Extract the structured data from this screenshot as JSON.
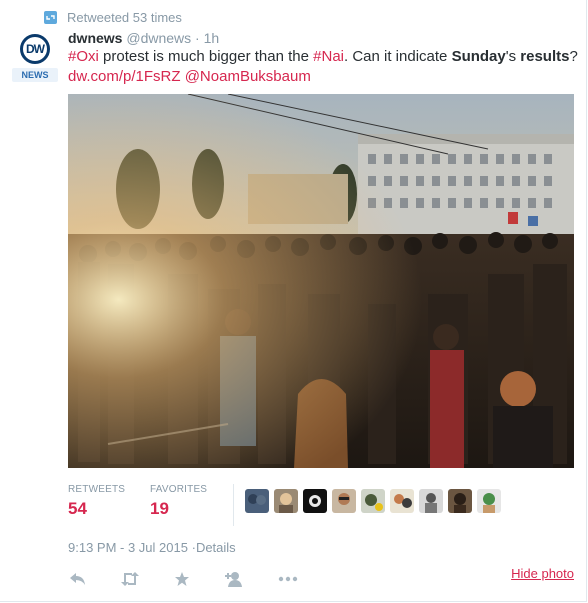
{
  "retweet": {
    "text": "Retweeted 53 times"
  },
  "author": {
    "name": "dwnews",
    "handle": "@dwnews",
    "separator": "·",
    "age": "1h",
    "avatar_tag": "NEWS",
    "avatar_logo": "DW"
  },
  "tweet": {
    "hashtag1": "#Oxi",
    "text1": " protest is much bigger than the ",
    "hashtag2": "#Nai",
    "text2": ". Can it indicate ",
    "bold1": "Sunday",
    "text3": "'s ",
    "bold2": "results",
    "text4": "?",
    "link": "dw.com/p/1FsRZ",
    "mention": "@NoamBuksbaum"
  },
  "stats": {
    "retweets_label": "RETWEETS",
    "retweets_count": "54",
    "favorites_label": "FAVORITES",
    "favorites_count": "19"
  },
  "timestamp": {
    "date": "9:13 PM - 3 Jul 2015",
    "separator": "·",
    "details": "Details"
  },
  "actions": {
    "icons": [
      "reply-icon",
      "retweet-icon",
      "favorite-icon",
      "follow-icon",
      "more-icon"
    ],
    "hide_photo": "Hide photo"
  },
  "colors": {
    "accent": "#d6274f",
    "muted": "#8899a6",
    "text": "#292f33",
    "retweet_icon": "#5ea9dd"
  }
}
